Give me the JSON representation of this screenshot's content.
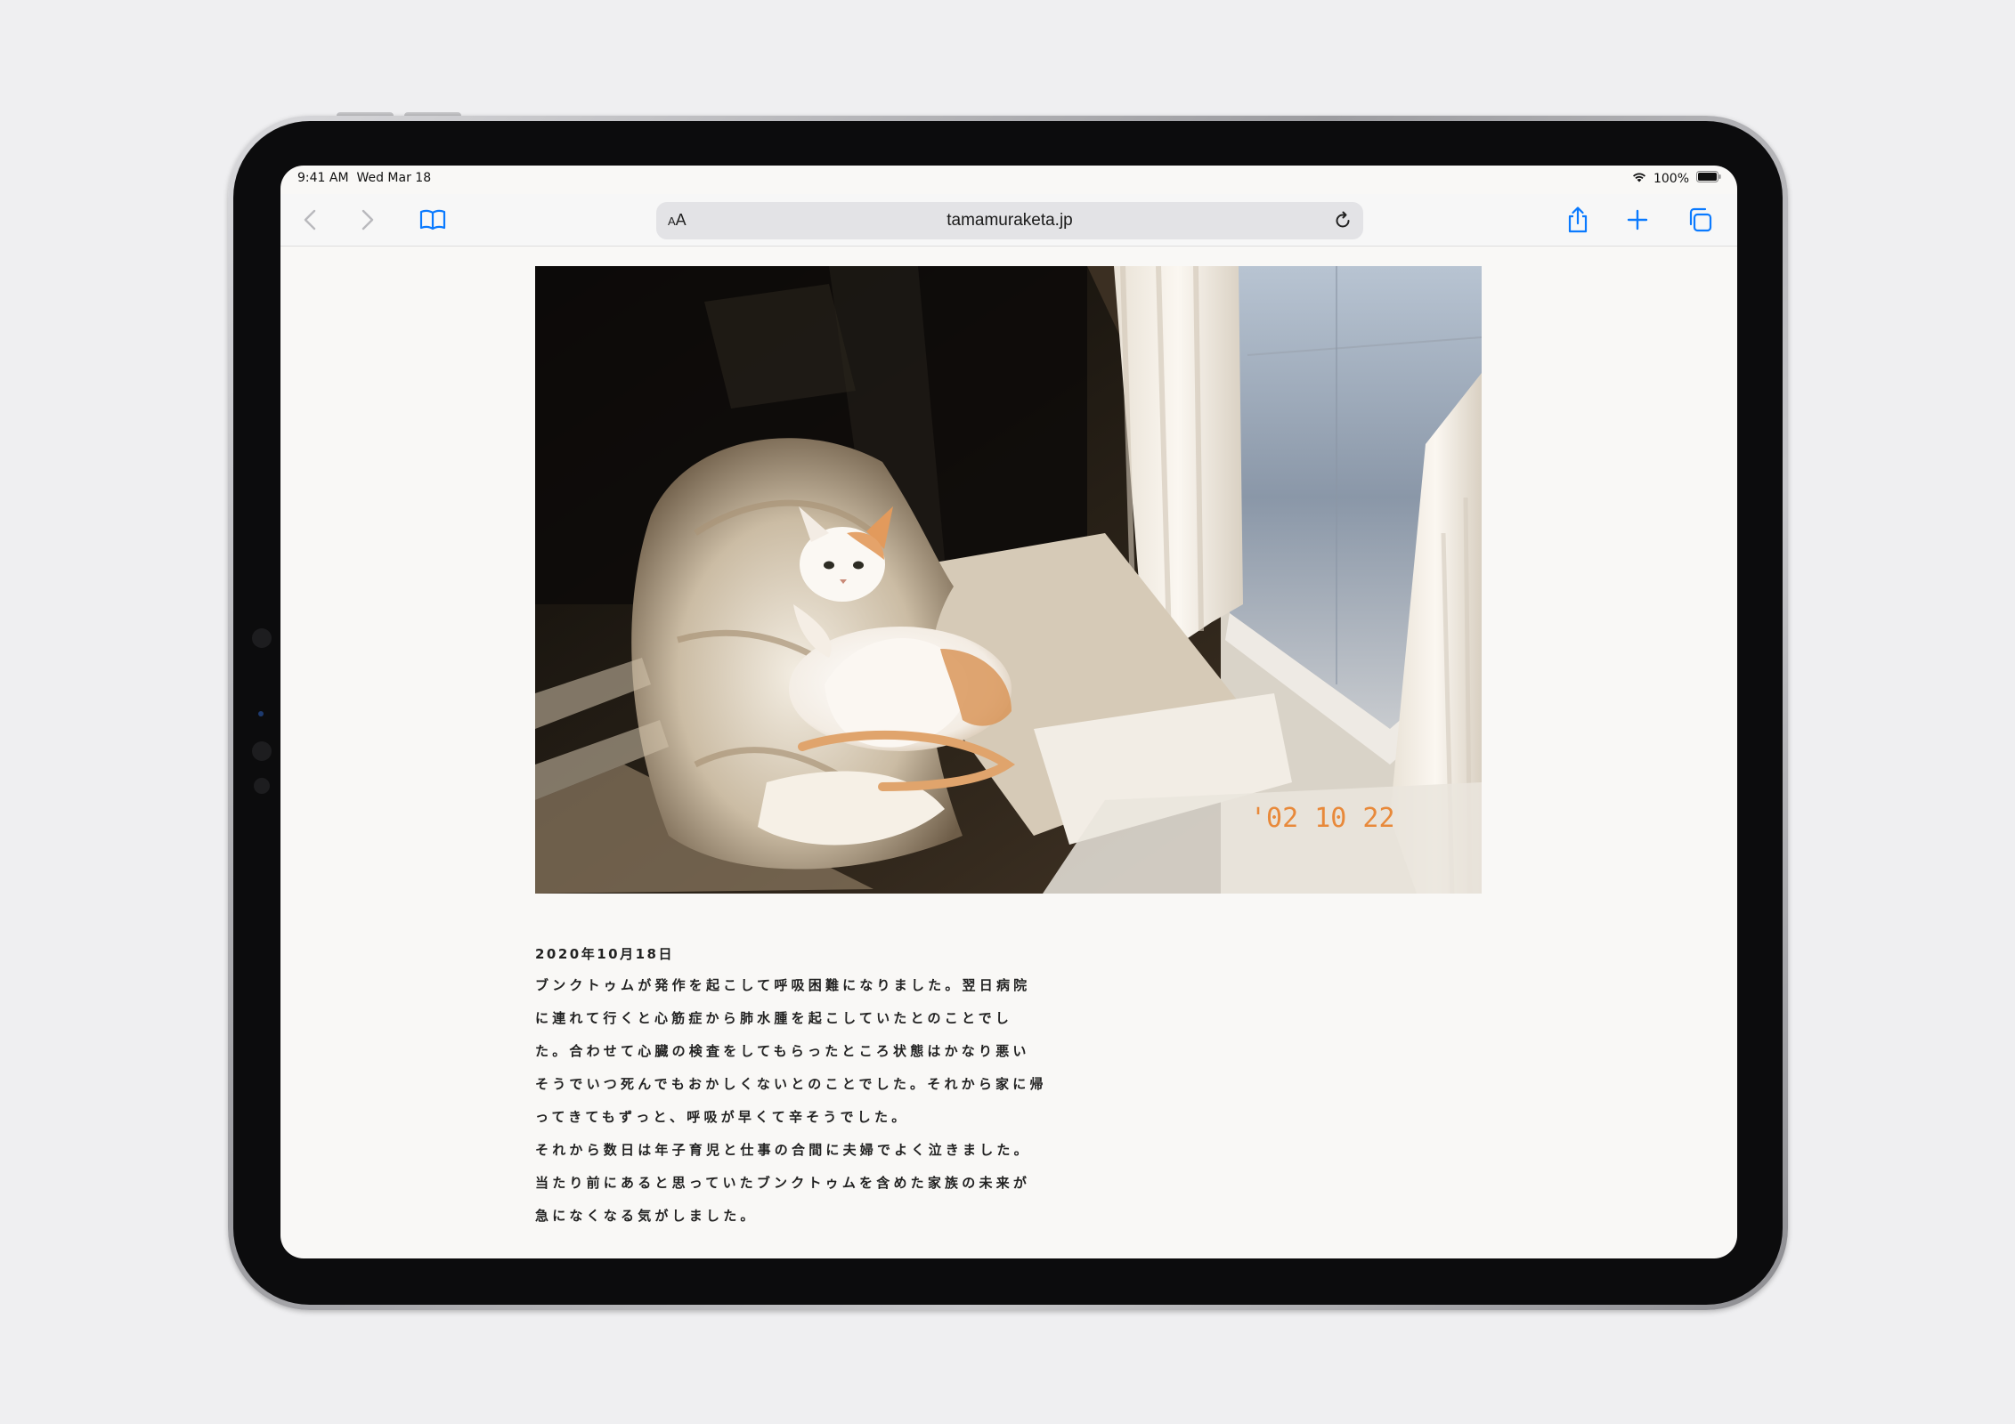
{
  "status": {
    "time": "9:41 AM",
    "date": "Wed Mar 18",
    "battery": "100%"
  },
  "toolbar": {
    "reader_label": "AA",
    "url": "tamamuraketa.jp"
  },
  "photo": {
    "stamp": "'02 10 22"
  },
  "article": {
    "date": "2020年10月18日",
    "lines": [
      "ブンクトゥムが発作を起こして呼吸困難になりました。翌日病院",
      "に連れて行くと心筋症から肺水腫を起こしていたとのことでし",
      "た。合わせて心臓の検査をしてもらったところ状態はかなり悪い",
      "そうでいつ死んでもおかしくないとのことでした。それから家に帰",
      "ってきてもずっと、呼吸が早くて辛そうでした。",
      "それから数日は年子育児と仕事の合間に夫婦でよく泣きました。",
      "当たり前にあると思っていたブンクトゥムを含めた家族の未来が",
      "急になくなる気がしました。"
    ]
  },
  "colors": {
    "accent": "#0a7aff",
    "page_bg": "#efeff1",
    "screen_bg": "#f9f8f6",
    "stamp": "#e8893a"
  }
}
